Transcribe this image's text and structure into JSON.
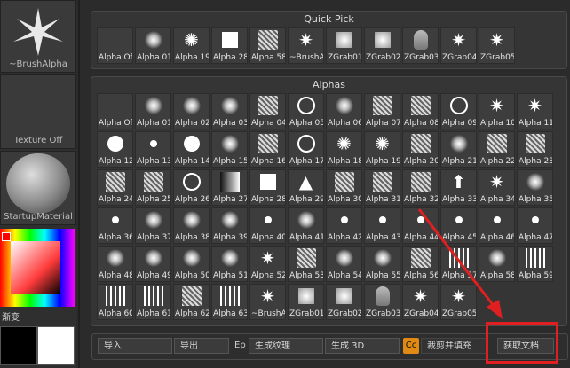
{
  "left_panel": {
    "brush_alpha_label": "~BrushAlpha",
    "texture_label": "Texture Off",
    "material_label": "StartupMaterial",
    "gradient_label": "渐变"
  },
  "quick_pick": {
    "title": "Quick Pick",
    "items": [
      {
        "label": "Alpha Off",
        "icon": "empty"
      },
      {
        "label": "Alpha 01",
        "icon": "soft-dot-icon"
      },
      {
        "label": "Alpha 19",
        "icon": "swirl-icon"
      },
      {
        "label": "Alpha 28",
        "icon": "square-icon"
      },
      {
        "label": "Alpha 58",
        "icon": "noise-icon"
      },
      {
        "label": "~BrushAlpha",
        "icon": "star-icon"
      },
      {
        "label": "ZGrab01",
        "icon": "soft-square-icon"
      },
      {
        "label": "ZGrab02",
        "icon": "soft-square-icon"
      },
      {
        "label": "ZGrab03",
        "icon": "face-icon"
      },
      {
        "label": "ZGrab04",
        "icon": "star-icon"
      },
      {
        "label": "ZGrab05",
        "icon": "star-icon"
      }
    ]
  },
  "alphas": {
    "title": "Alphas",
    "items": [
      "Alpha Off",
      "Alpha 01",
      "Alpha 02",
      "Alpha 03",
      "Alpha 04",
      "Alpha 05",
      "Alpha 06",
      "Alpha 07",
      "Alpha 08",
      "Alpha 09",
      "Alpha 10",
      "Alpha 11",
      "Alpha 12",
      "Alpha 13",
      "Alpha 14",
      "Alpha 15",
      "Alpha 16",
      "Alpha 17",
      "Alpha 18",
      "Alpha 19",
      "Alpha 20",
      "Alpha 21",
      "Alpha 22",
      "Alpha 23",
      "Alpha 24",
      "Alpha 25",
      "Alpha 26",
      "Alpha 27",
      "Alpha 28",
      "Alpha 29",
      "Alpha 30",
      "Alpha 31",
      "Alpha 32",
      "Alpha 33",
      "Alpha 34",
      "Alpha 35",
      "Alpha 36",
      "Alpha 37",
      "Alpha 38",
      "Alpha 39",
      "Alpha 40",
      "Alpha 41",
      "Alpha 42",
      "Alpha 43",
      "Alpha 44",
      "Alpha 45",
      "Alpha 46",
      "Alpha 47",
      "Alpha 48",
      "Alpha 49",
      "Alpha 50",
      "Alpha 51",
      "Alpha 52",
      "Alpha 53",
      "Alpha 54",
      "Alpha 55",
      "Alpha 56",
      "Alpha 57",
      "Alpha 58",
      "Alpha 59",
      "Alpha 60",
      "Alpha 61",
      "Alpha 62",
      "Alpha 63",
      "~BrushAlpha",
      "ZGrab01",
      "ZGrab02",
      "ZGrab03",
      "ZGrab04",
      "ZGrab05"
    ],
    "icons": [
      "empty",
      "soft-dot-icon",
      "soft-dot-icon",
      "soft-dot-icon",
      "noise-icon",
      "ring-icon",
      "soft-dot-icon",
      "noise-icon",
      "noise-icon",
      "ring-icon",
      "star-icon",
      "star-icon",
      "hard-dot-icon",
      "small-dot-icon",
      "hard-dot-icon",
      "soft-dot-icon",
      "noise-icon",
      "ring-icon",
      "swirl-icon",
      "swirl-icon",
      "noise-icon",
      "soft-dot-icon",
      "noise-icon",
      "noise-icon",
      "noise-icon",
      "noise-icon",
      "ring-icon",
      "gradient-icon",
      "square-icon",
      "tree-icon",
      "noise-icon",
      "noise-icon",
      "noise-icon",
      "arrow-up-icon",
      "star-icon",
      "soft-dot-icon",
      "small-dot-icon",
      "soft-dot-icon",
      "soft-dot-icon",
      "soft-dot-icon",
      "small-dot-icon",
      "soft-dot-icon",
      "small-dot-icon",
      "small-dot-icon",
      "small-dot-icon",
      "small-dot-icon",
      "small-dot-icon",
      "small-dot-icon",
      "soft-dot-icon",
      "soft-dot-icon",
      "soft-dot-icon",
      "soft-dot-icon",
      "star-icon",
      "noise-icon",
      "soft-dot-icon",
      "soft-dot-icon",
      "noise-icon",
      "bars-icon",
      "soft-dot-icon",
      "bars-icon",
      "bars-icon",
      "bars-icon",
      "noise-icon",
      "bars-icon",
      "star-icon",
      "soft-square-icon",
      "soft-square-icon",
      "face-icon",
      "star-icon",
      "star-icon"
    ]
  },
  "bottom_bar": {
    "import_label": "导入",
    "export_label": "导出",
    "ep_label": "Ep",
    "make_texture_label": "生成纹理",
    "make_3d_label": "生成 3D",
    "cc_label": "Cc",
    "crop_fill_label": "裁剪并填充",
    "get_doc_label": "获取文档"
  },
  "colors": {
    "highlight": "#e02020",
    "cc_accent": "#e08a14"
  }
}
